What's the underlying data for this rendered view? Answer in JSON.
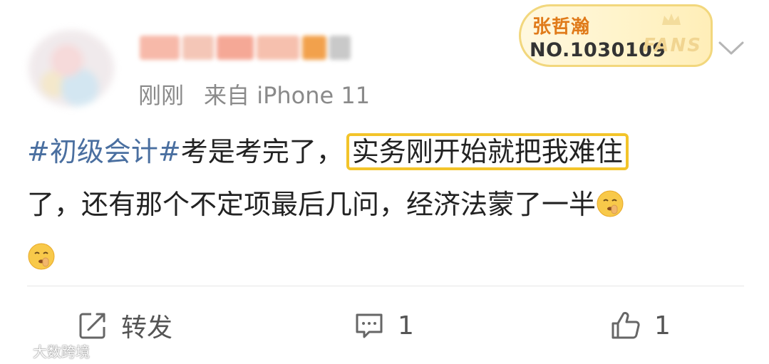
{
  "post": {
    "meta": {
      "time": "刚刚",
      "source": "来自 iPhone 11"
    },
    "fan_badge": {
      "name": "张哲瀚",
      "number": "NO.1030109",
      "deco": "FANS"
    },
    "content": {
      "hashtag": "#初级会计#",
      "text_before": "考是考完了，",
      "highlight": "实务刚开始就把我难住",
      "text_after": "了，还有那个不定项最后几问，经济法蒙了一半"
    },
    "actions": {
      "repost_label": "转发",
      "comment_count": "1",
      "like_count": "1"
    }
  },
  "watermark": {
    "text": "大数跨境"
  },
  "colors": {
    "hashtag": "#4a6fa0",
    "highlight_border": "#f3c42a",
    "badge_name": "#e07b1a",
    "muted": "#8a8a8a"
  },
  "icons": [
    "chevron-down-icon",
    "repost-icon",
    "comment-icon",
    "like-icon",
    "shush-emoji",
    "watermark-logo-icon"
  ]
}
